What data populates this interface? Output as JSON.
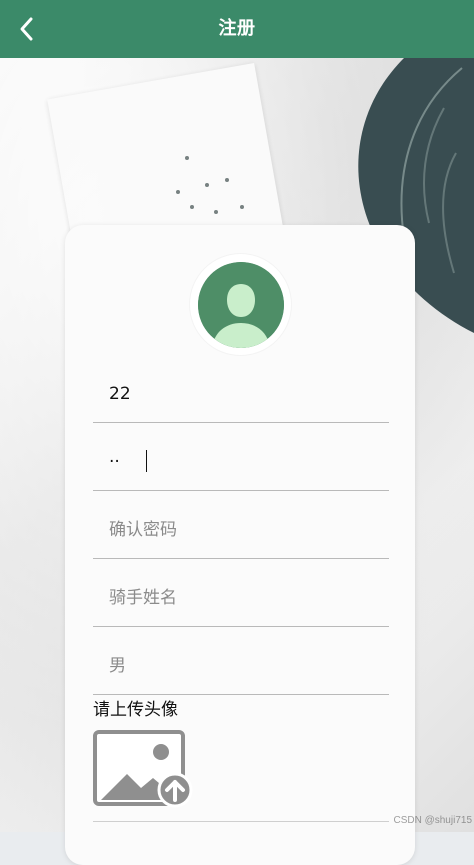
{
  "header": {
    "title": "注册",
    "back_icon": "chevron-left-icon"
  },
  "colors": {
    "header_bg": "#3b8a69",
    "card_bg": "#fbfbfb",
    "avatar_bg": "#4e8e67",
    "avatar_figure": "#c9eecb"
  },
  "form": {
    "avatar_icon": "user-avatar-icon",
    "fields": [
      {
        "value": "22",
        "placeholder": ""
      },
      {
        "value": "··",
        "placeholder": ""
      },
      {
        "value": "",
        "placeholder": "确认密码"
      },
      {
        "value": "",
        "placeholder": "骑手姓名"
      },
      {
        "value": "",
        "placeholder": "男"
      }
    ],
    "upload": {
      "label": "请上传头像",
      "icon": "image-upload-icon"
    }
  },
  "watermark": "CSDN @shuji715"
}
